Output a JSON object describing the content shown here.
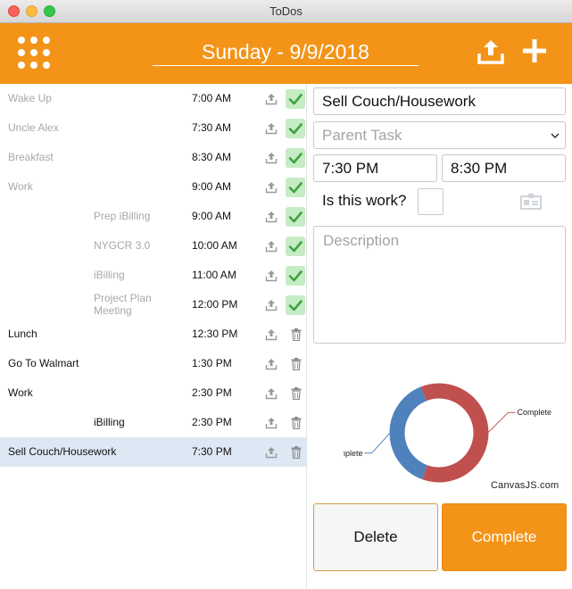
{
  "window": {
    "title": "ToDos"
  },
  "header": {
    "date_title": "Sunday - 9/9/2018"
  },
  "tasks": [
    {
      "name": "Wake Up",
      "time": "7:00 AM",
      "done": true,
      "indent": false
    },
    {
      "name": "Uncle Alex",
      "time": "7:30 AM",
      "done": true,
      "indent": false
    },
    {
      "name": "Breakfast",
      "time": "8:30 AM",
      "done": true,
      "indent": false
    },
    {
      "name": "Work",
      "time": "9:00 AM",
      "done": true,
      "indent": false
    },
    {
      "name": "Prep iBilling",
      "time": "9:00 AM",
      "done": true,
      "indent": true
    },
    {
      "name": "NYGCR 3.0",
      "time": "10:00 AM",
      "done": true,
      "indent": true
    },
    {
      "name": "iBilling",
      "time": "11:00 AM",
      "done": true,
      "indent": true
    },
    {
      "name": "Project Plan Meeting",
      "time": "12:00 PM",
      "done": true,
      "indent": true
    },
    {
      "name": "Lunch",
      "time": "12:30 PM",
      "done": false,
      "indent": false
    },
    {
      "name": "Go To Walmart",
      "time": "1:30 PM",
      "done": false,
      "indent": false
    },
    {
      "name": "Work",
      "time": "2:30 PM",
      "done": false,
      "indent": false
    },
    {
      "name": "iBilling",
      "time": "2:30 PM",
      "done": false,
      "indent": true
    },
    {
      "name": "Sell Couch/Housework",
      "time": "7:30 PM",
      "done": false,
      "indent": false,
      "selected": true
    }
  ],
  "detail": {
    "task_name": "Sell Couch/Housework",
    "parent_task_placeholder": "Parent Task",
    "start_time": "7:30 PM",
    "end_time": "8:30 PM",
    "work_label": "Is this work?",
    "description_placeholder": "Description"
  },
  "chart_data": {
    "type": "pie",
    "style": "doughnut",
    "slices": [
      {
        "label": "Complete",
        "value": 8,
        "color": "#c0504e"
      },
      {
        "label": "Incomplete",
        "value": 5,
        "color": "#4f81bc"
      }
    ],
    "credit": "CanvasJS.com"
  },
  "buttons": {
    "delete": "Delete",
    "complete": "Complete"
  },
  "colors": {
    "accent": "#f39418",
    "done_text": "#a8a8a8",
    "open_text": "#111111",
    "check_bg": "#c6ecc6",
    "check_mark": "#3ea33e",
    "selected_row": "#dde8f4"
  },
  "icons": {
    "menu": "grid-dots-icon",
    "header_action": "upload-icon",
    "add": "plus-icon",
    "row_action": "upload-icon",
    "done": "checkmark-icon",
    "delete": "trash-icon",
    "card": "id-card-icon",
    "dropdown": "chevron-down-icon"
  }
}
